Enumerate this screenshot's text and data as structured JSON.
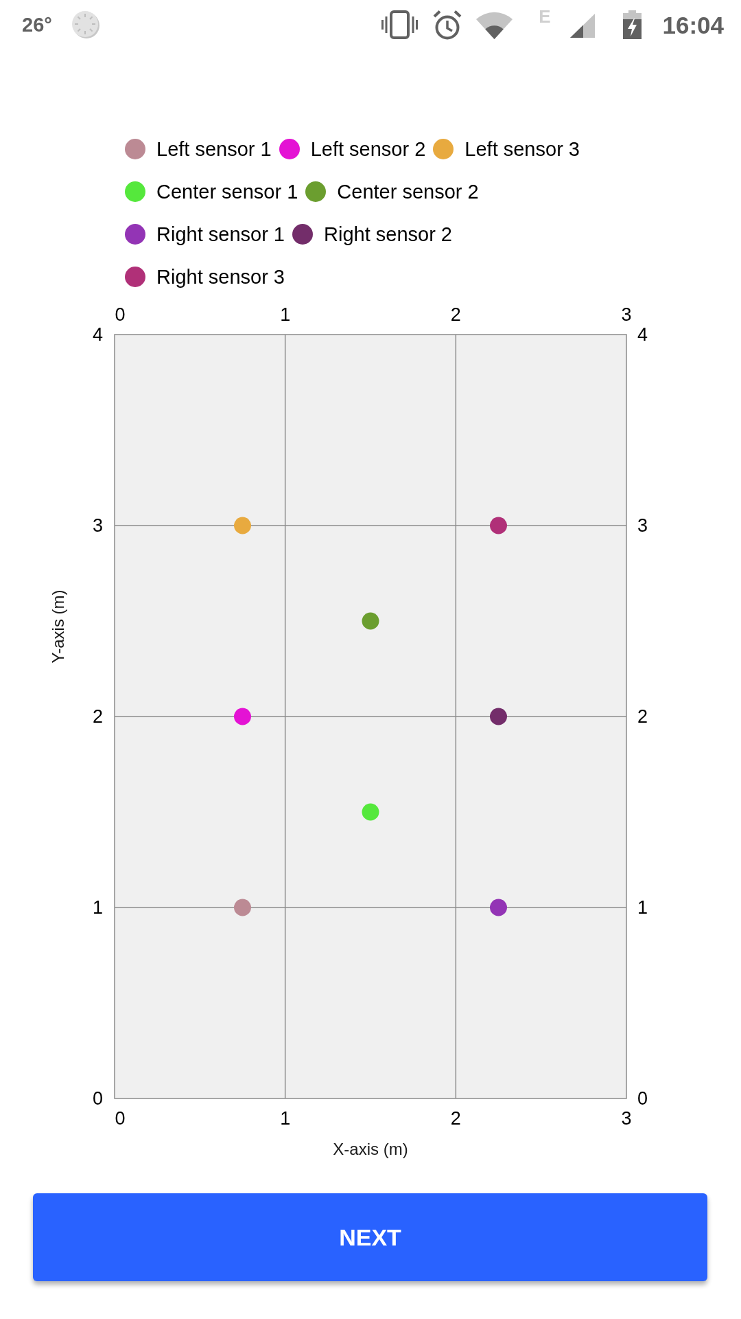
{
  "status_bar": {
    "temperature": "26°",
    "network_type": "E",
    "time": "16:04"
  },
  "chart": {
    "chart_data": {
      "type": "scatter",
      "xlabel": "X-axis (m)",
      "ylabel": "Y-axis (m)",
      "x": [
        0.75,
        1.5,
        2.25
      ],
      "series": [
        {
          "name": "Left sensor 1",
          "color": "#bc8a94",
          "values": [
            1,
            null,
            null
          ]
        },
        {
          "name": "Left sensor 2",
          "color": "#e413d4",
          "values": [
            2,
            null,
            null
          ]
        },
        {
          "name": "Left sensor 3",
          "color": "#e8aa3f",
          "values": [
            3,
            null,
            null
          ]
        },
        {
          "name": "Center sensor 1",
          "color": "#55e83c",
          "values": [
            null,
            1.5,
            null
          ]
        },
        {
          "name": "Center sensor 2",
          "color": "#6b9e2f",
          "values": [
            null,
            2.5,
            null
          ]
        },
        {
          "name": "Right sensor 1",
          "color": "#9334b5",
          "values": [
            null,
            null,
            1
          ]
        },
        {
          "name": "Right sensor 2",
          "color": "#732d6a",
          "values": [
            null,
            null,
            2
          ]
        },
        {
          "name": "Right sensor 3",
          "color": "#b03078",
          "values": [
            null,
            null,
            3
          ]
        }
      ],
      "xlim": [
        0,
        3
      ],
      "ylim": [
        0,
        4
      ],
      "xticks": [
        0,
        1,
        2,
        3
      ],
      "yticks": [
        0,
        1,
        2,
        3,
        4
      ],
      "grid": true,
      "legend": "top"
    },
    "top_axis_labels": [
      "0",
      "1",
      "2",
      "3"
    ],
    "left_axis_labels": [
      "4",
      "3",
      "2",
      "1",
      "0"
    ],
    "right_axis_labels": [
      "4",
      "3",
      "2",
      "1",
      "0"
    ],
    "bottom_axis_labels": [
      "0",
      "1",
      "2",
      "3"
    ]
  },
  "button": {
    "label": "NEXT"
  }
}
